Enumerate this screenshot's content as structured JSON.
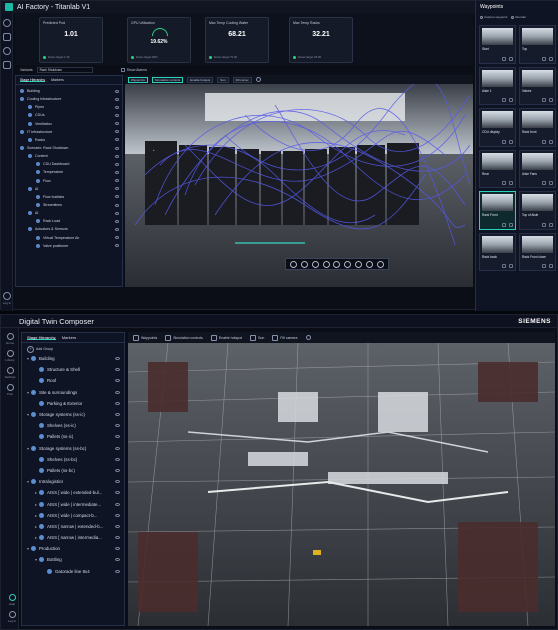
{
  "app1": {
    "title": "AI Factory - Titanlab V1",
    "kpis": [
      {
        "title": "Predicted Pod",
        "value": "1.01",
        "below": "below target 1.30"
      },
      {
        "title": "GPU Utilization",
        "value": "19.62%",
        "below": "below target 90%"
      },
      {
        "title": "Max Temp Cooling Water",
        "value": "68.21",
        "below": "below target 70.00"
      },
      {
        "title": "Max Temp Racks",
        "value": "32.21",
        "below": "below target 35.00"
      }
    ],
    "variants": {
      "label": "Variants",
      "selected": "Rack Shutdown",
      "show_alarms": "Show Alarms"
    },
    "panel_tabs": [
      "Stage Hierarchy",
      "Markers"
    ],
    "tree": [
      {
        "label": "Building",
        "level": 1
      },
      {
        "label": "Cooling Infrastructure",
        "level": 1
      },
      {
        "label": "Pipes",
        "level": 2
      },
      {
        "label": "CDUs",
        "level": 2
      },
      {
        "label": "Ventilation",
        "level": 2
      },
      {
        "label": "IT Infrastructure",
        "level": 1
      },
      {
        "label": "Racks",
        "level": 2
      },
      {
        "label": "Scenario: Rack Shutdown",
        "level": 1
      },
      {
        "label": "Content",
        "level": 2
      },
      {
        "label": "CDU Dashboard",
        "level": 3
      },
      {
        "label": "Temperature",
        "level": 3
      },
      {
        "label": "Flow",
        "level": 3
      },
      {
        "label": "AI",
        "level": 2
      },
      {
        "label": "Flow bubbles",
        "level": 3
      },
      {
        "label": "Streamlines",
        "level": 3
      },
      {
        "label": "AI",
        "level": 2
      },
      {
        "label": "Rack Load",
        "level": 3
      },
      {
        "label": "Actuators & Sensors",
        "level": 2
      },
      {
        "label": "Virtual Temperature Air",
        "level": 3
      },
      {
        "label": "Valve positioner",
        "level": 3
      }
    ],
    "viewport_tools": [
      "Waypoints",
      "Simulation controls",
      "Enable hotspot",
      "Sun",
      "Fill cursor"
    ],
    "rail_bottom": "Log In",
    "waypoints": {
      "title": "Waypoints",
      "options": [
        "Capture waypoint",
        "Reorder"
      ],
      "items": [
        "Start",
        "Top",
        "Aisle 1",
        "Valves",
        "CDU display",
        "Rack front",
        "Rear",
        "Aisle Fans",
        "Rack Front",
        "Top of Aisle",
        "Rack back",
        "Rack Front close"
      ],
      "active_index": 8
    }
  },
  "app2": {
    "title": "Digital Twin Composer",
    "brand": "SIEMENS",
    "panel_tabs": [
      "Stage Hierarchy",
      "Markers"
    ],
    "add_group": "Add Group",
    "rail_items": [
      "Home",
      "Library",
      "Settings",
      "Twin"
    ],
    "rail_bottom": [
      "Help",
      "Log In"
    ],
    "tree": [
      {
        "label": "Building",
        "level": 1,
        "expand": "v"
      },
      {
        "label": "Structure & Shell",
        "level": 2,
        "expand": ""
      },
      {
        "label": "Roof",
        "level": 2,
        "expand": ""
      },
      {
        "label": "Site & surroundings",
        "level": 1,
        "expand": "v"
      },
      {
        "label": "Parking & Exterior",
        "level": 2,
        "expand": ""
      },
      {
        "label": "Storage systems (ss-ic)",
        "level": 1,
        "expand": "v"
      },
      {
        "label": "Shelves (ss-ic)",
        "level": 2,
        "expand": ""
      },
      {
        "label": "Pallets (ss-ic)",
        "level": 2,
        "expand": ""
      },
      {
        "label": "Storage systems (ss-bc)",
        "level": 1,
        "expand": "v"
      },
      {
        "label": "Shelves (ss-bc)",
        "level": 2,
        "expand": ""
      },
      {
        "label": "Pallets (ss-bc)",
        "level": 2,
        "expand": ""
      },
      {
        "label": "Intralogistics",
        "level": 1,
        "expand": "v"
      },
      {
        "label": "AISS [ wide | extended-bul...",
        "level": 2,
        "expand": ">"
      },
      {
        "label": "AISS [ wide | intermediate...",
        "level": 2,
        "expand": ">"
      },
      {
        "label": "AISS [ wide | compact-b...",
        "level": 2,
        "expand": ">"
      },
      {
        "label": "AISS [ narrow | extended-b...",
        "level": 2,
        "expand": ">"
      },
      {
        "label": "AISS [ narrow | intermedia...",
        "level": 2,
        "expand": ">"
      },
      {
        "label": "Production",
        "level": 1,
        "expand": "v"
      },
      {
        "label": "Bottling",
        "level": 2,
        "expand": "v"
      },
      {
        "label": "Gatorade line 8x4",
        "level": 3,
        "expand": ""
      }
    ],
    "viewport_tools": [
      "Waypoints",
      "Simulation controls",
      "Enable hotspot",
      "Sun",
      "Fill camera"
    ]
  }
}
